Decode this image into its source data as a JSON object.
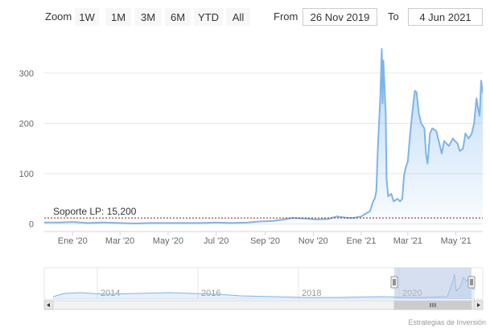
{
  "toolbar": {
    "zoom_label": "Zoom",
    "buttons": [
      "1W",
      "1M",
      "3M",
      "6M",
      "YTD",
      "All"
    ],
    "from_label": "From",
    "from_value": "26 Nov 2019",
    "to_label": "To",
    "to_value": "4 Jun 2021"
  },
  "support_line": {
    "label": "Soporte LP: 15,200",
    "value": 12,
    "color": "#8b1a1a"
  },
  "colors": {
    "series": "#7cb5ec",
    "navigator_mask": "#b4c4e4",
    "grid": "#e6e6e6"
  },
  "chart_data": {
    "type": "area",
    "x_tick_labels": [
      "Ene '20",
      "Mar '20",
      "May '20",
      "Jul '20",
      "Sep '20",
      "Nov '20",
      "Ene '21",
      "Mar '21",
      "May '21"
    ],
    "x_ticks": [
      "2020-01-01",
      "2020-03-01",
      "2020-05-01",
      "2020-07-01",
      "2020-09-01",
      "2020-11-01",
      "2021-01-01",
      "2021-03-01",
      "2021-05-01"
    ],
    "y_ticks": [
      0,
      100,
      200,
      300
    ],
    "xlim": [
      "2019-11-26",
      "2021-06-04"
    ],
    "ylim": [
      -15,
      375
    ],
    "grid": true,
    "series": [
      {
        "points": [
          [
            "2019-11-26",
            3
          ],
          [
            "2019-12-15",
            3
          ],
          [
            "2020-01-01",
            4
          ],
          [
            "2020-01-20",
            2
          ],
          [
            "2020-02-10",
            3
          ],
          [
            "2020-03-01",
            2
          ],
          [
            "2020-03-20",
            1
          ],
          [
            "2020-04-10",
            2
          ],
          [
            "2020-05-01",
            2
          ],
          [
            "2020-05-20",
            2
          ],
          [
            "2020-06-10",
            2
          ],
          [
            "2020-07-01",
            3
          ],
          [
            "2020-07-20",
            2
          ],
          [
            "2020-08-10",
            3
          ],
          [
            "2020-08-25",
            5
          ],
          [
            "2020-09-10",
            6
          ],
          [
            "2020-09-25",
            9
          ],
          [
            "2020-10-05",
            12
          ],
          [
            "2020-10-20",
            11
          ],
          [
            "2020-11-05",
            9
          ],
          [
            "2020-11-20",
            10
          ],
          [
            "2020-12-01",
            15
          ],
          [
            "2020-12-15",
            12
          ],
          [
            "2020-12-22",
            12
          ],
          [
            "2021-01-01",
            15
          ],
          [
            "2021-01-08",
            22
          ],
          [
            "2021-01-12",
            25
          ],
          [
            "2021-01-16",
            45
          ],
          [
            "2021-01-18",
            50
          ],
          [
            "2021-01-20",
            65
          ],
          [
            "2021-01-22",
            150
          ],
          [
            "2021-01-25",
            250
          ],
          [
            "2021-01-27",
            348
          ],
          [
            "2021-01-28",
            240
          ],
          [
            "2021-01-29",
            325
          ],
          [
            "2021-02-01",
            220
          ],
          [
            "2021-02-02",
            90
          ],
          [
            "2021-02-04",
            55
          ],
          [
            "2021-02-08",
            60
          ],
          [
            "2021-02-11",
            45
          ],
          [
            "2021-02-16",
            50
          ],
          [
            "2021-02-19",
            45
          ],
          [
            "2021-02-22",
            50
          ],
          [
            "2021-02-24",
            95
          ],
          [
            "2021-02-26",
            110
          ],
          [
            "2021-03-01",
            125
          ],
          [
            "2021-03-04",
            180
          ],
          [
            "2021-03-08",
            240
          ],
          [
            "2021-03-10",
            265
          ],
          [
            "2021-03-12",
            262
          ],
          [
            "2021-03-15",
            220
          ],
          [
            "2021-03-18",
            200
          ],
          [
            "2021-03-22",
            190
          ],
          [
            "2021-03-24",
            140
          ],
          [
            "2021-03-26",
            120
          ],
          [
            "2021-03-29",
            180
          ],
          [
            "2021-04-01",
            190
          ],
          [
            "2021-04-06",
            185
          ],
          [
            "2021-04-10",
            160
          ],
          [
            "2021-04-13",
            140
          ],
          [
            "2021-04-16",
            165
          ],
          [
            "2021-04-19",
            160
          ],
          [
            "2021-04-22",
            155
          ],
          [
            "2021-04-27",
            170
          ],
          [
            "2021-04-30",
            165
          ],
          [
            "2021-05-03",
            160
          ],
          [
            "2021-05-06",
            145
          ],
          [
            "2021-05-10",
            150
          ],
          [
            "2021-05-13",
            180
          ],
          [
            "2021-05-17",
            170
          ],
          [
            "2021-05-21",
            180
          ],
          [
            "2021-05-24",
            200
          ],
          [
            "2021-05-27",
            250
          ],
          [
            "2021-05-29",
            230
          ],
          [
            "2021-05-31",
            215
          ],
          [
            "2021-06-02",
            285
          ],
          [
            "2021-06-04",
            260
          ]
        ]
      }
    ]
  },
  "navigator": {
    "year_labels": [
      "2014",
      "2016",
      "2018",
      "2020"
    ]
  },
  "credits": "Estrategias de Inversión"
}
